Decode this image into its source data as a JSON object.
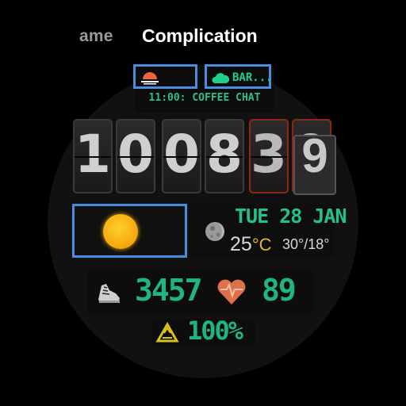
{
  "header": {
    "prev_tab_label": "ame",
    "current_tab_label": "Complication"
  },
  "complications": {
    "top_right_text": "BAR...",
    "event_text": "11:00: COFFEE CHAT"
  },
  "time": {
    "digits": [
      "1",
      "0",
      "0",
      "8",
      "3",
      "9"
    ],
    "flipping_digit": "9"
  },
  "weather": {
    "date": "TUE 28 JAN",
    "temperature": "25",
    "unit": "°C",
    "range": "30°/18°"
  },
  "stats": {
    "steps": "3457",
    "heart_rate": "89",
    "battery": "100%"
  },
  "colors": {
    "accent_green": "#1fb57f",
    "slot_outline": "#4a8de0",
    "seconds_border": "#8a2a14",
    "heart": "#e0704a",
    "recycle": "#d8c21a"
  }
}
